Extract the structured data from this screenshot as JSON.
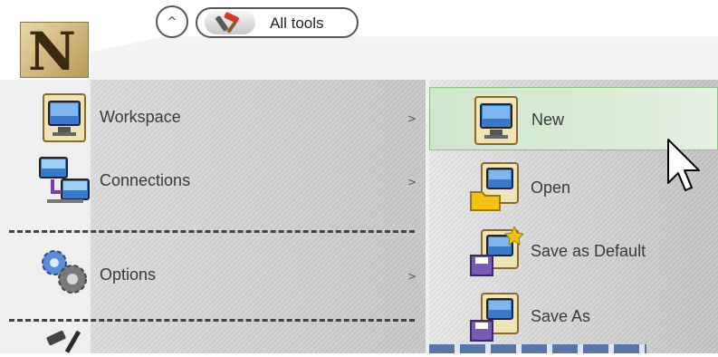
{
  "toolbar": {
    "collapse_symbol": "^",
    "all_tools_label": "All tools",
    "all_tools_icon": "tools-icon"
  },
  "app_logo": {
    "letter": "N"
  },
  "main_menu": {
    "items": [
      {
        "label": "Workspace",
        "arrow": ">",
        "icon": "monitor-document-icon"
      },
      {
        "label": "Connections",
        "arrow": ">",
        "icon": "network-computers-icon"
      },
      {
        "label": "Options",
        "arrow": ">",
        "icon": "gears-icon"
      }
    ],
    "partial_item_icon": "hammer-icon"
  },
  "sub_menu": {
    "items": [
      {
        "label": "New",
        "icon": "monitor-document-icon",
        "active": true
      },
      {
        "label": "Open",
        "icon": "monitor-folder-icon",
        "active": false
      },
      {
        "label": "Save as Default",
        "icon": "monitor-save-star-icon",
        "active": false
      },
      {
        "label": "Save As",
        "icon": "monitor-save-icon",
        "active": false
      }
    ]
  },
  "colors": {
    "active_highlight": "#d3e9cf",
    "active_border": "#8fbf8a",
    "separator": "#444444"
  }
}
